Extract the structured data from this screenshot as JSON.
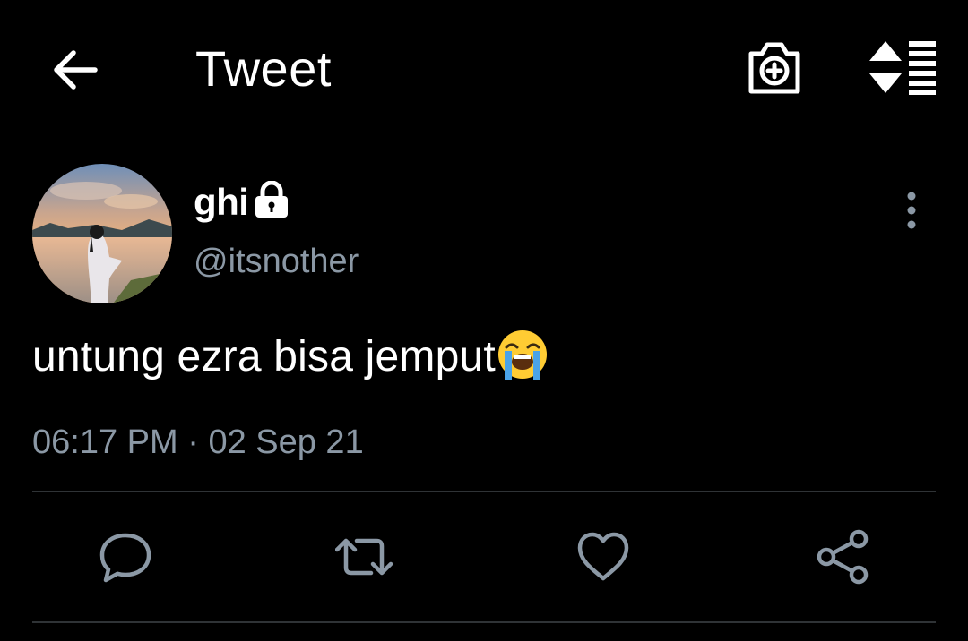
{
  "header": {
    "title": "Tweet",
    "back_icon": "arrow-left-icon",
    "camera_icon": "camera-plus-icon",
    "sort_icon": "sort-list-icon"
  },
  "author": {
    "display_name": "ghi",
    "handle": "@itsnother",
    "protected_icon": "lock-icon",
    "more_icon": "more-vertical-icon"
  },
  "tweet": {
    "text": "untung ezra bisa jemput",
    "emoji_icon": "loudly-crying-face-emoji",
    "time": "06:17 PM",
    "separator": "·",
    "date": "02 Sep 21"
  },
  "actions": [
    {
      "icon": "reply-icon"
    },
    {
      "icon": "retweet-icon"
    },
    {
      "icon": "like-icon"
    },
    {
      "icon": "share-icon"
    }
  ],
  "colors": {
    "background": "#000000",
    "text": "#ffffff",
    "secondary_text": "#8b98a5",
    "divider": "#2f3336"
  }
}
